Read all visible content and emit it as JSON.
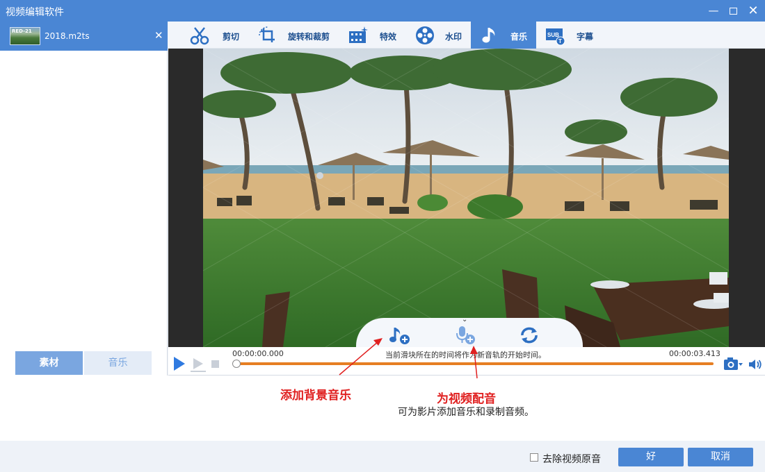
{
  "window": {
    "title": "视频编辑软件"
  },
  "sidebar": {
    "file_name": "2018.m2ts",
    "thumb_stamp": "RED-21",
    "tabs": [
      {
        "label": "素材",
        "active": true
      },
      {
        "label": "音乐",
        "active": false
      }
    ]
  },
  "toolbar": {
    "tabs": [
      {
        "label": "剪切",
        "icon": "cut-icon",
        "active": false
      },
      {
        "label": "旋转和裁剪",
        "icon": "rotate-crop-icon",
        "active": false
      },
      {
        "label": "特效",
        "icon": "effects-icon",
        "active": false
      },
      {
        "label": "水印",
        "icon": "watermark-icon",
        "active": false
      },
      {
        "label": "音乐",
        "icon": "music-note-icon",
        "active": true
      },
      {
        "label": "字幕",
        "icon": "subtitle-icon",
        "active": false
      }
    ]
  },
  "timeline": {
    "start_time": "00:00:00.000",
    "end_time": "00:00:03.413",
    "hint": "当前滑块所在的时间将作为新音轨的开始时间。",
    "progress_fraction": 0.0
  },
  "annotations": {
    "add_bgm": "添加背景音乐",
    "voiceover": "为视频配音"
  },
  "info": {
    "description": "可为影片添加音乐和录制音频。"
  },
  "footer": {
    "remove_audio_label": "去除视频原音",
    "remove_audio_checked": false,
    "ok_label": "好",
    "cancel_label": "取消"
  },
  "colors": {
    "accent": "#4a86d4",
    "timeline": "#e67e22",
    "annotation": "#e02020"
  }
}
